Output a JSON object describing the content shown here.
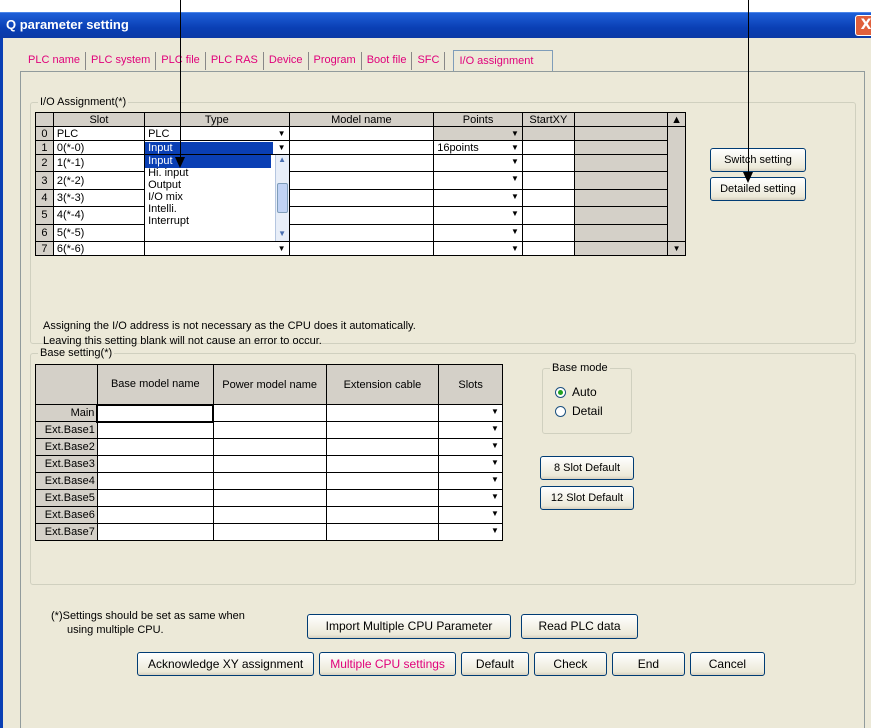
{
  "window": {
    "title": "Q parameter setting",
    "close_glyph": "X"
  },
  "tabs": [
    "PLC name",
    "PLC system",
    "PLC file",
    "PLC RAS",
    "Device",
    "Program",
    "Boot file",
    "SFC",
    "I/O assignment"
  ],
  "io": {
    "group_label": "I/O Assignment(*)",
    "headers": [
      "Slot",
      "Type",
      "Model name",
      "Points",
      "StartXY"
    ],
    "rows": [
      {
        "n": "0",
        "slot": "PLC",
        "type": "PLC",
        "points": ""
      },
      {
        "n": "1",
        "slot": "0(*-0)",
        "type": "Input",
        "points": "16points"
      },
      {
        "n": "2",
        "slot": "1(*-1)",
        "type": "",
        "points": ""
      },
      {
        "n": "3",
        "slot": "2(*-2)",
        "type": "",
        "points": ""
      },
      {
        "n": "4",
        "slot": "3(*-3)",
        "type": "",
        "points": ""
      },
      {
        "n": "5",
        "slot": "4(*-4)",
        "type": "",
        "points": ""
      },
      {
        "n": "6",
        "slot": "5(*-5)",
        "type": "",
        "points": ""
      },
      {
        "n": "7",
        "slot": "6(*-6)",
        "type": "",
        "points": ""
      }
    ],
    "type_dropdown_options": [
      "Input",
      "Hi. input",
      "Output",
      "I/O mix",
      "Intelli.",
      "Interrupt"
    ],
    "switch_button": "Switch setting",
    "detailed_button": "Detailed setting",
    "note_line1": "Assigning the I/O address is not necessary as the CPU does it automatically.",
    "note_line2": "Leaving this setting blank will not cause an error to occur."
  },
  "base": {
    "group_label": "Base setting(*)",
    "headers": [
      "Base model name",
      "Power model name",
      "Extension cable",
      "Slots"
    ],
    "rows": [
      "Main",
      "Ext.Base1",
      "Ext.Base2",
      "Ext.Base3",
      "Ext.Base4",
      "Ext.Base5",
      "Ext.Base6",
      "Ext.Base7"
    ],
    "mode_label": "Base mode",
    "mode_auto": "Auto",
    "mode_detail": "Detail",
    "mode_selected": "Auto",
    "slot8_button": "8 Slot Default",
    "slot12_button": "12 Slot Default"
  },
  "footer_note_line1": "(*)Settings should be set as same when",
  "footer_note_line2": "using multiple CPU.",
  "import_button": "Import Multiple CPU Parameter",
  "read_button": "Read PLC data",
  "bottom_buttons": [
    "Acknowledge XY assignment",
    "Multiple CPU settings",
    "Default",
    "Check",
    "End",
    "Cancel"
  ],
  "colors": {
    "accent_pink": "#e0007a",
    "title_blue": "#0a3fb4",
    "panel": "#ece9d8"
  }
}
